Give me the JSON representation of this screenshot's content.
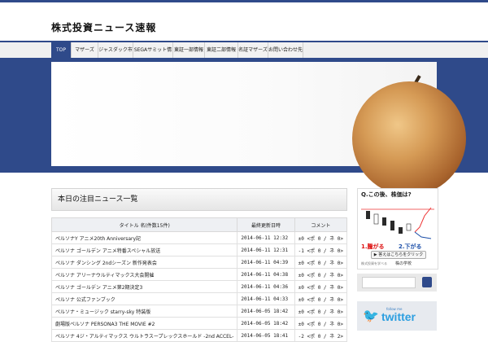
{
  "site": {
    "title": "株式投資ニュース速報"
  },
  "nav": {
    "items": [
      {
        "label": "TOP"
      },
      {
        "label": "マザーズ"
      },
      {
        "label": "ジャスダック市場"
      },
      {
        "label": "SEGAサミット情報"
      },
      {
        "label": "東証一部情報"
      },
      {
        "label": "東証二部情報"
      },
      {
        "label": "名証マザーズ"
      },
      {
        "label": "お問い合わせ先"
      }
    ]
  },
  "main": {
    "panel_title": "本日の注目ニュース一覧",
    "columns": [
      "タイトル 名(件数15件)",
      "最終更新日時",
      "コメント"
    ],
    "rows": [
      {
        "title": "ペルソナY アニメ20th Anniversary記",
        "date": "2014-06-11 12:32",
        "comments": "±0 <ポ 0 / ネ 0>"
      },
      {
        "title": "ペルソナ ゴールデン アニメ特番スペシャル放送",
        "date": "2014-06-11 12:31",
        "comments": "-1 <ポ 0 / ネ 0>"
      },
      {
        "title": "ペルソナ ダンシング 2ndシーズン 新作発表会",
        "date": "2014-06-11 04:39",
        "comments": "±0 <ポ 0 / ネ 0>"
      },
      {
        "title": "ペルソナ アリーナウルティマックス大会開催",
        "date": "2014-06-11 04:38",
        "comments": "±0 <ポ 0 / ネ 0>"
      },
      {
        "title": "ペルソナ ゴールデン アニメ第2期決定3",
        "date": "2014-06-11 04:36",
        "comments": "±0 <ポ 0 / ネ 0>"
      },
      {
        "title": "ペルソナ 公式ファンブック",
        "date": "2014-06-11 04:33",
        "comments": "±0 <ポ 0 / ネ 0>"
      },
      {
        "title": "ペルソナ・ミュージック starry-sky 特装版",
        "date": "2014-06-05 18:42",
        "comments": "±0 <ポ 0 / ネ 0>"
      },
      {
        "title": "劇場版ペルソナ PERSONA3 THE MOVIE #2",
        "date": "2014-06-05 18:42",
        "comments": "±0 <ポ 0 / ネ 0>"
      },
      {
        "title": "ペルソナ 4ジ・アルティマックス ウルトラスープレックスホールド -2nd ACCEL-",
        "date": "2014-06-05 18:41",
        "comments": "-2 <ポ 0 / ネ 2>"
      }
    ]
  },
  "sidebar": {
    "ad": {
      "question": "Q.この後、株価は?",
      "option1": "1.騰がる",
      "option2": "2.下がる",
      "cta": "▶ 答えはこちらをクリック",
      "brand": "株の学校",
      "small": "株式投資を学べる"
    },
    "search": {
      "placeholder": ""
    },
    "twitter": {
      "small": "follow me",
      "big": "twitter",
      "bird": "🐦"
    }
  },
  "colors": {
    "accent": "#2f4a8a",
    "twitter": "#2d9fe0"
  }
}
